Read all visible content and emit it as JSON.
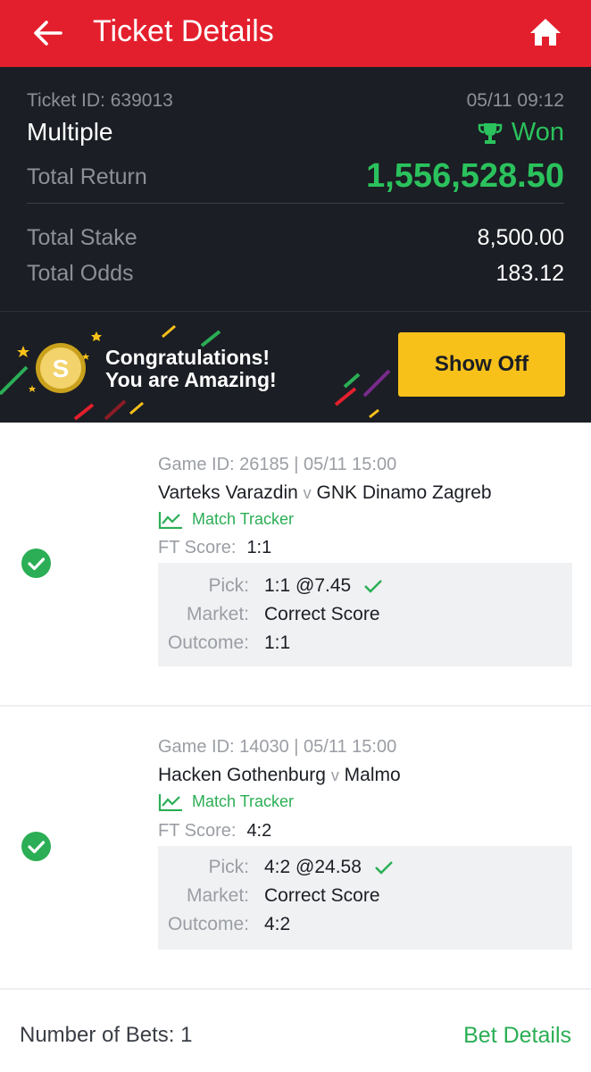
{
  "header": {
    "title": "Ticket Details",
    "back_icon": "arrow-left-icon",
    "home_icon": "home-icon",
    "bg_color": "#e41f2d"
  },
  "summary": {
    "ticket_id": "Ticket ID: 639013",
    "datetime": "05/11 09:12",
    "bet_type": "Multiple",
    "status": "Won",
    "status_icon": "trophy-icon",
    "total_return_label": "Total Return",
    "total_return_value": "1,556,528.50",
    "total_stake_label": "Total Stake",
    "total_stake_value": "8,500.00",
    "total_odds_label": "Total Odds",
    "total_odds_value": "183.12",
    "accent_color": "#2bc25d"
  },
  "banner": {
    "line1": "Congratulations!",
    "line2": "You are Amazing!",
    "coin_icon": "coin-icon",
    "button_label": "Show Off",
    "button_color": "#f8c11a"
  },
  "bets": [
    {
      "meta": "Game ID: 26185 | 05/11 15:00",
      "home": "Varteks Varazdin",
      "vs": "v",
      "away": "GNK Dinamo Zagreb",
      "tracker_label": "Match Tracker",
      "ft_label": "FT Score:",
      "ft_value": "1:1",
      "pick_label": "Pick:",
      "pick_value": "1:1 @7.45",
      "market_label": "Market:",
      "market_value": "Correct Score",
      "outcome_label": "Outcome:",
      "outcome_value": "1:1",
      "result": "won"
    },
    {
      "meta": "Game ID: 14030 | 05/11 15:00",
      "home": "Hacken Gothenburg",
      "vs": "v",
      "away": "Malmo",
      "tracker_label": "Match Tracker",
      "ft_label": "FT Score:",
      "ft_value": "4:2",
      "pick_label": "Pick:",
      "pick_value": "4:2 @24.58",
      "market_label": "Market:",
      "market_value": "Correct Score",
      "outcome_label": "Outcome:",
      "outcome_value": "4:2",
      "result": "won"
    }
  ],
  "footer": {
    "bets_count": "Number of Bets: 1",
    "details_link": "Bet Details"
  }
}
